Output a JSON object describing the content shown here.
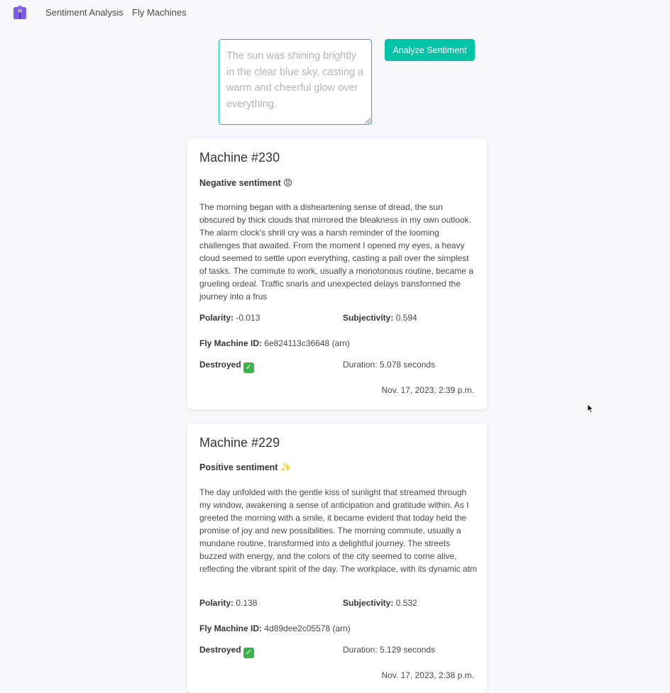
{
  "nav": {
    "links": [
      "Sentiment Analysis",
      "Fly Machines"
    ]
  },
  "form": {
    "placeholder": "The sun was shining brightly in the clear blue sky, casting a warm and cheerful glow over everything.",
    "button_label": "Analyze Sentiment"
  },
  "labels": {
    "polarity": "Polarity:",
    "subjectivity": "Subjectivity:",
    "machine_id": "Fly Machine ID:",
    "destroyed": "Destroyed",
    "duration_prefix": "Duration:"
  },
  "machines": [
    {
      "title": "Machine #230",
      "sentiment": "Negative sentiment",
      "sentiment_emoji": "😡",
      "text": "The morning began with a disheartening sense of dread, the sun obscured by thick clouds that mirrored the bleakness in my own outlook. The alarm clock's shrill cry was a harsh reminder of the looming challenges that awaited. From the moment I opened my eyes, a heavy cloud seemed to settle upon everything, casting a pall over the simplest of tasks. The commute to work, usually a monotonous routine, became a grueling ordeal. Traffic snarls and unexpected delays transformed the journey into a frus",
      "polarity": "-0.013",
      "subjectivity": "0.594",
      "machine_id": "6e824113c36648 (arn)",
      "duration": "5.078 seconds",
      "date": "Nov. 17, 2023, 2:39 p.m."
    },
    {
      "title": "Machine #229",
      "sentiment": "Positive sentiment",
      "sentiment_emoji": "✨",
      "text": "The day unfolded with the gentle kiss of sunlight that streamed through my window, awakening a sense of anticipation and gratitude within. As I greeted the morning with a smile, it became evident that today held the promise of joy and new possibilities. The morning commute, usually a mundane routine, transformed into a delightful journey. The streets buzzed with energy, and the colors of the city seemed to come alive, reflecting the vibrant spirit of the day. The workplace, with its dynamic atm",
      "polarity": "0.138",
      "subjectivity": "0.532",
      "machine_id": "4d89dee2c05578 (arn)",
      "duration": "5.129 seconds",
      "date": "Nov. 17, 2023, 2:38 p.m."
    }
  ],
  "colors": {
    "accent": "#00c4a7",
    "background": "#f8f8fb",
    "check": "#3ab54a"
  }
}
